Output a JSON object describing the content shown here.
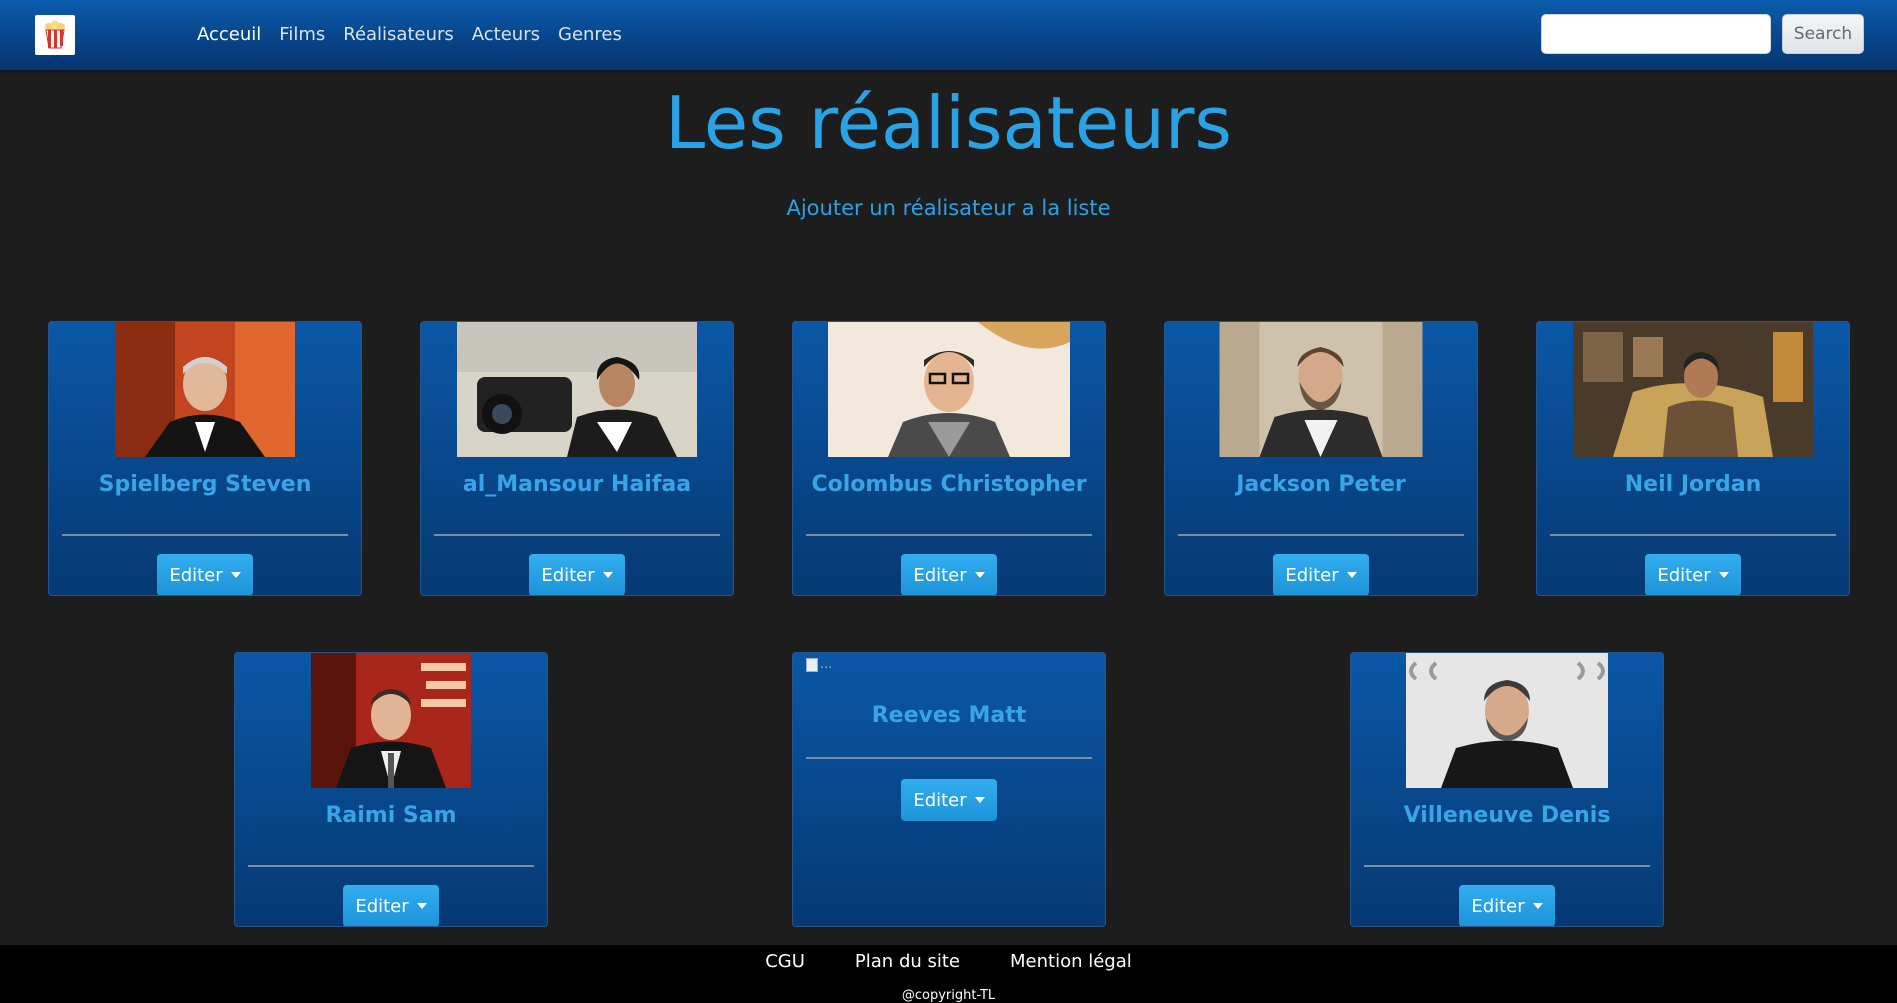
{
  "navbar": {
    "logo_icon": "popcorn-icon",
    "links": [
      "Acceuil",
      "Films",
      "Réalisateurs",
      "Acteurs",
      "Genres"
    ],
    "search_placeholder": "",
    "search_button": "Search"
  },
  "main": {
    "title": "Les réalisateurs",
    "add_link": "Ajouter un réalisateur a la liste",
    "directors": [
      {
        "name": "Spielberg Steven",
        "edit_label": "Editer"
      },
      {
        "name": "al_Mansour Haifaa",
        "edit_label": "Editer"
      },
      {
        "name": "Colombus Christopher",
        "edit_label": "Editer"
      },
      {
        "name": "Jackson Peter",
        "edit_label": "Editer"
      },
      {
        "name": "Neil Jordan",
        "edit_label": "Editer"
      },
      {
        "name": "Raimi Sam",
        "edit_label": "Editer"
      },
      {
        "name": "Reeves Matt",
        "edit_label": "Editer",
        "broken_image_alt": "..."
      },
      {
        "name": "Villeneuve Denis",
        "edit_label": "Editer"
      }
    ]
  },
  "footer": {
    "links": [
      "CGU",
      "Plan du site",
      "Mention légal"
    ],
    "copyright": "@copyright-TL"
  },
  "colors": {
    "navbar": "#0b5cad",
    "accent": "#2aa3e6",
    "background": "#1d1d1d",
    "button": "#33aef0",
    "footer": "#000000"
  }
}
